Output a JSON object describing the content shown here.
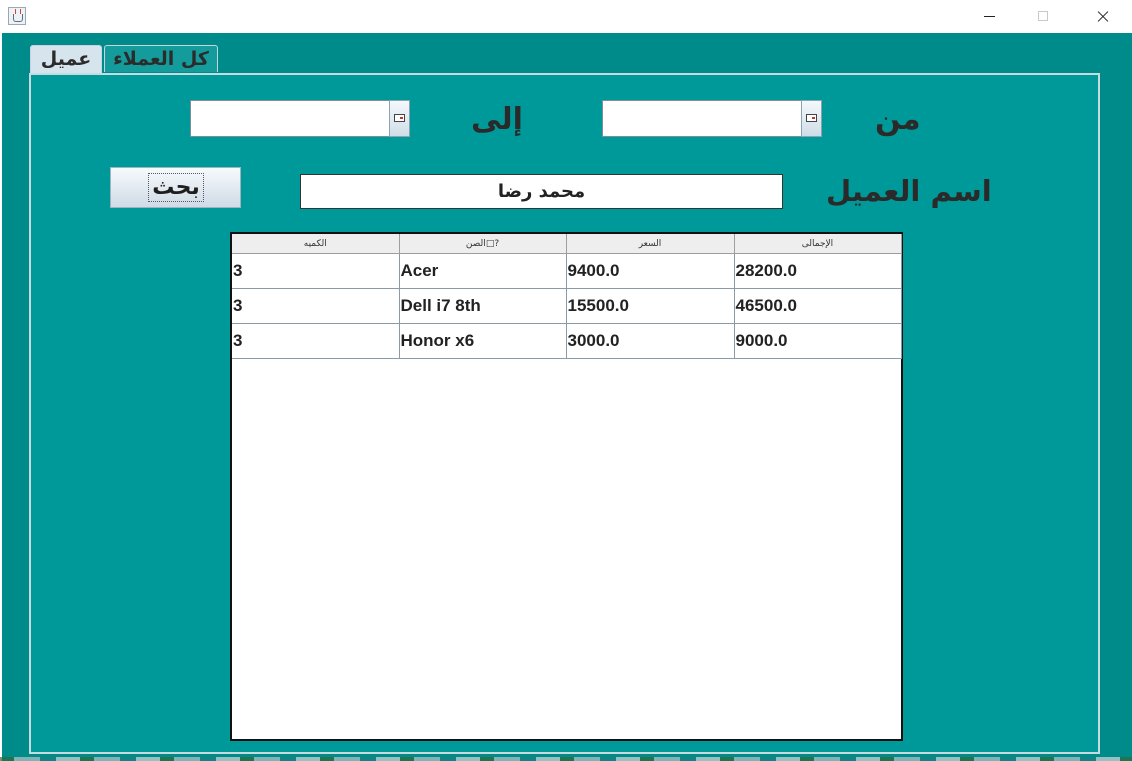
{
  "tabs": [
    {
      "label": "عميل",
      "active": true
    },
    {
      "label": "كل العملاء",
      "active": false
    }
  ],
  "filters": {
    "from_label": "من",
    "to_label": "إلى",
    "from_value": "",
    "to_value": ""
  },
  "customer": {
    "label": "اسم العميل",
    "value": "محمد رضا"
  },
  "search_button": {
    "label": "بحث"
  },
  "table": {
    "headers": [
      "الكميه",
      "الصن□?",
      "السعر",
      "الإجمالى"
    ],
    "rows": [
      [
        "3",
        "Acer",
        "9400.0",
        "28200.0"
      ],
      [
        "3",
        "Dell i7 8th",
        "15500.0",
        "46500.0"
      ],
      [
        "3",
        "Honor x6",
        "3000.0",
        "9000.0"
      ]
    ]
  },
  "colors": {
    "window_bg": "#008b8b",
    "panel_bg": "#009999",
    "tab_active": "#d6e4ee"
  },
  "icons": {
    "app": "java-cup-icon",
    "date_picker": "calendar-icon"
  }
}
